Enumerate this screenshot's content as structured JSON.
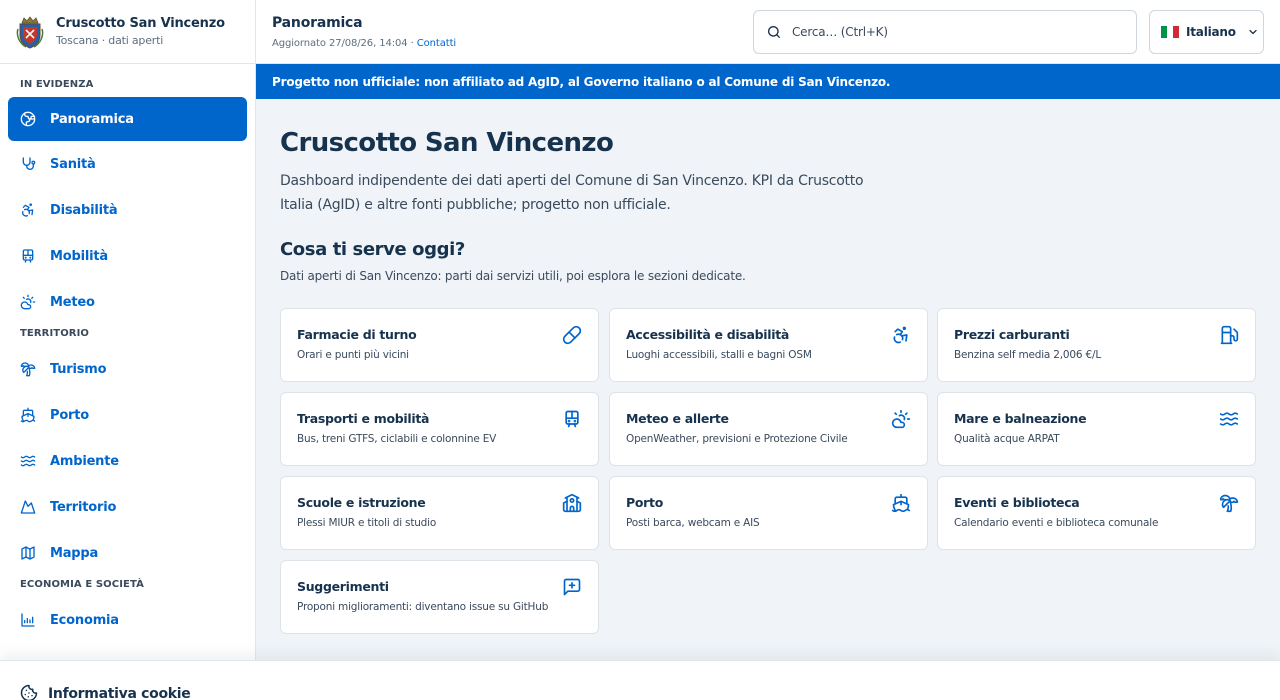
{
  "brand": {
    "title": "Cruscotto San Vincenzo",
    "subtitle": "Toscana · dati aperti"
  },
  "sidebar": {
    "sections": [
      {
        "label": "IN EVIDENZA",
        "items": [
          {
            "label": "Panoramica",
            "icon": "globe-icon",
            "active": true
          },
          {
            "label": "Sanità",
            "icon": "stethoscope-icon"
          },
          {
            "label": "Disabilità",
            "icon": "accessibility-icon"
          },
          {
            "label": "Mobilità",
            "icon": "bus-icon"
          },
          {
            "label": "Meteo",
            "icon": "sun-cloud-icon"
          }
        ]
      },
      {
        "label": "TERRITORIO",
        "items": [
          {
            "label": "Turismo",
            "icon": "palm-tree-icon"
          },
          {
            "label": "Porto",
            "icon": "ship-icon"
          },
          {
            "label": "Ambiente",
            "icon": "waves-icon"
          },
          {
            "label": "Territorio",
            "icon": "mountain-icon"
          },
          {
            "label": "Mappa",
            "icon": "map-icon"
          }
        ]
      },
      {
        "label": "ECONOMIA E SOCIETÀ",
        "items": [
          {
            "label": "Economia",
            "icon": "chart-icon"
          }
        ]
      }
    ]
  },
  "header": {
    "title": "Panoramica",
    "updated": "Aggiornato 27/08/26, 14:04 · ",
    "contacts_link": "Contatti",
    "search_placeholder": "Cerca… (Ctrl+K)",
    "language": "Italiano"
  },
  "banner": "Progetto non ufficiale: non affiliato ad AgID, al Governo italiano o al Comune di San Vincenzo.",
  "main": {
    "title": "Cruscotto San Vincenzo",
    "lead": "Dashboard indipendente dei dati aperti del Comune di San Vincenzo. KPI da Cruscotto Italia (AgID) e altre fonti pubbliche; progetto non ufficiale.",
    "section_title": "Cosa ti serve oggi?",
    "section_sub": "Dati aperti di San Vincenzo: parti dai servizi utili, poi esplora le sezioni dedicate.",
    "cards": [
      {
        "title": "Farmacie di turno",
        "desc": "Orari e punti più vicini",
        "icon": "pill-icon"
      },
      {
        "title": "Accessibilità e disabilità",
        "desc": "Luoghi accessibili, stalli e bagni OSM",
        "icon": "accessibility-icon"
      },
      {
        "title": "Prezzi carburanti",
        "desc": "Benzina self media 2,006 €/L",
        "icon": "fuel-icon"
      },
      {
        "title": "Trasporti e mobilità",
        "desc": "Bus, treni GTFS, ciclabili e colonnine EV",
        "icon": "bus-icon"
      },
      {
        "title": "Meteo e allerte",
        "desc": "OpenWeather, previsioni e Protezione Civile",
        "icon": "sun-cloud-icon"
      },
      {
        "title": "Mare e balneazione",
        "desc": "Qualità acque ARPAT",
        "icon": "waves-icon"
      },
      {
        "title": "Scuole e istruzione",
        "desc": "Plessi MIUR e titoli di studio",
        "icon": "school-icon"
      },
      {
        "title": "Porto",
        "desc": "Posti barca, webcam e AIS",
        "icon": "ship-icon"
      },
      {
        "title": "Eventi e biblioteca",
        "desc": "Calendario eventi e biblioteca comunale",
        "icon": "palm-tree-icon"
      },
      {
        "title": "Suggerimenti",
        "desc": "Proponi miglioramenti: diventano issue su GitHub",
        "icon": "message-plus-icon"
      }
    ]
  },
  "cookie": {
    "title": "Informativa cookie"
  },
  "colors": {
    "accent": "#0066cc",
    "text_dark": "#17324d",
    "background": "#f0f4f8"
  }
}
